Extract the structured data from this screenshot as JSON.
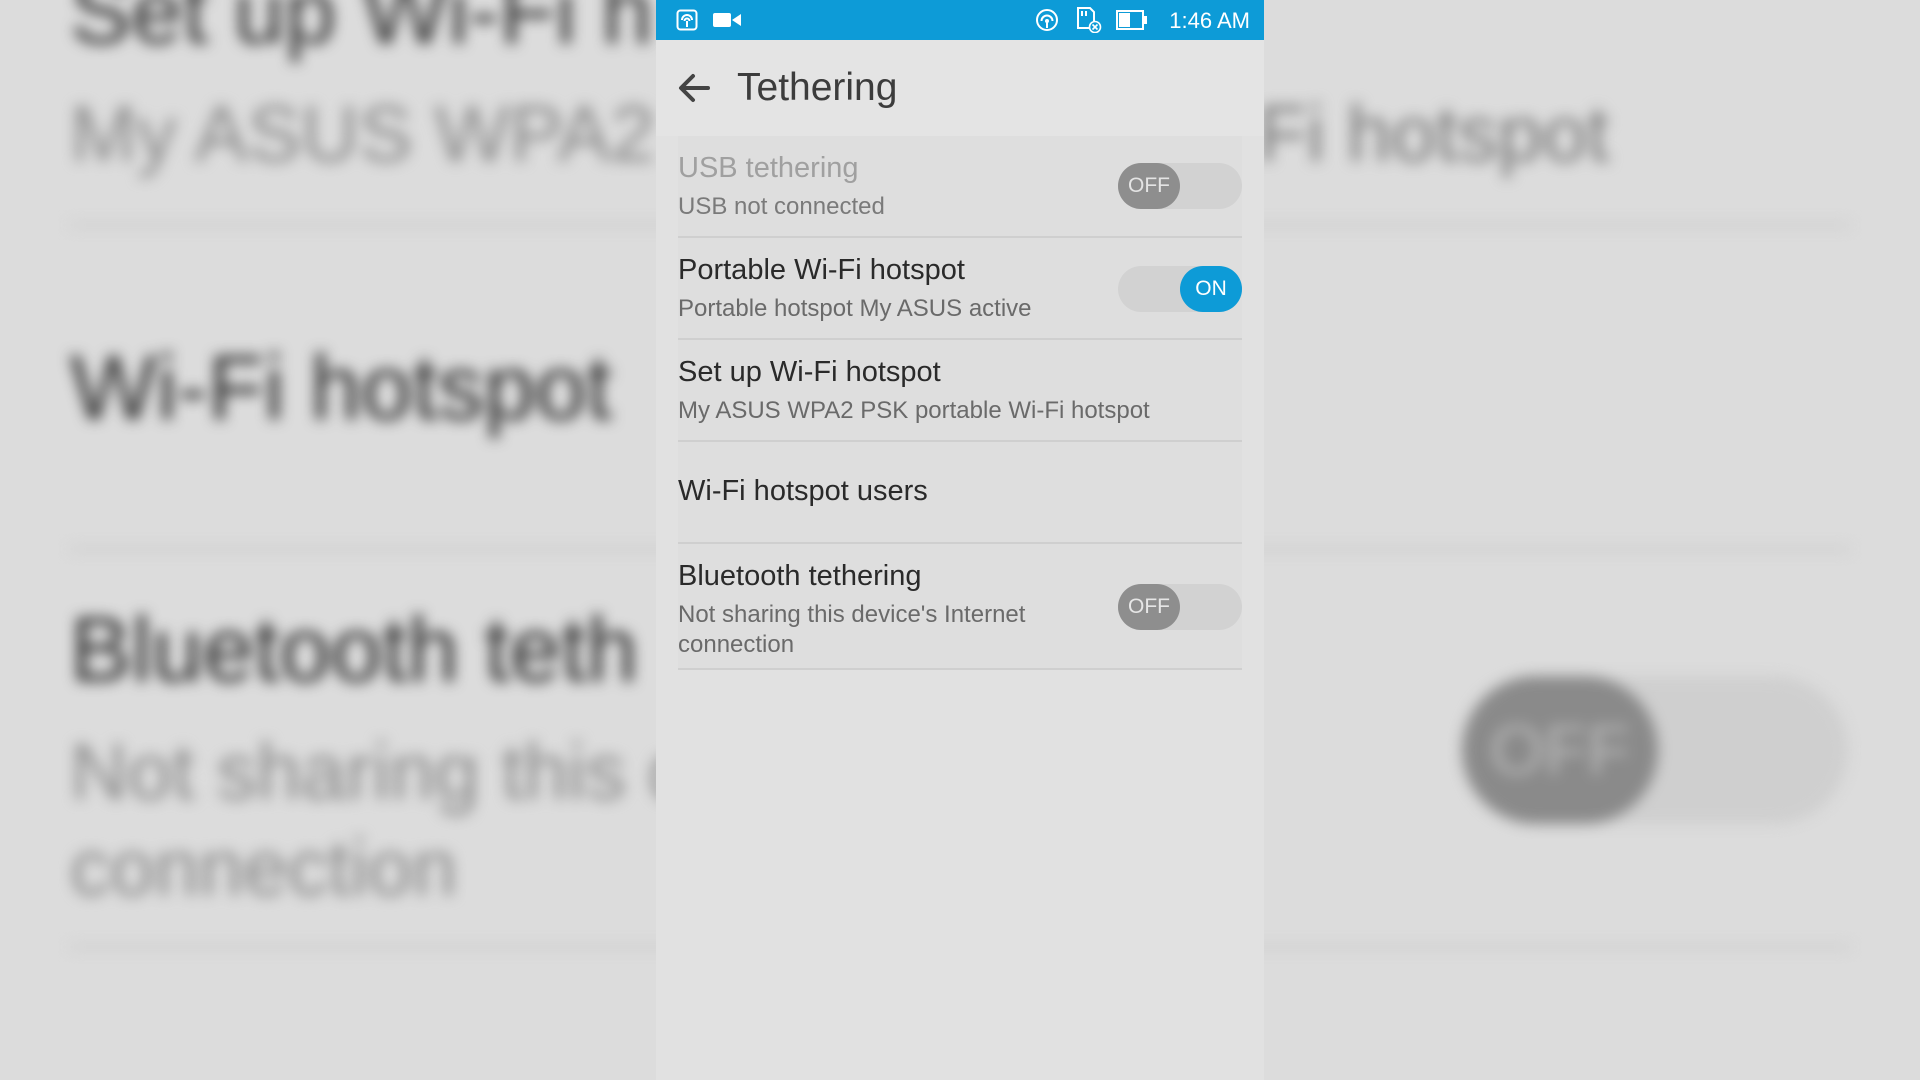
{
  "status_bar": {
    "left_icons": [
      "hotspot-icon",
      "video-camera-icon"
    ],
    "right_icons": [
      "hotspot-active-icon",
      "sd-card-icon",
      "battery-icon"
    ],
    "time": "1:46 AM",
    "color": "#0d9bd7"
  },
  "app_bar": {
    "title": "Tethering",
    "back_icon": "arrow-left-icon"
  },
  "settings": [
    {
      "id": "usb-tethering",
      "title": "USB tethering",
      "summary": "USB not connected",
      "toggle": "OFF",
      "enabled": false
    },
    {
      "id": "wifi-hotspot",
      "title": "Portable Wi-Fi hotspot",
      "summary": "Portable hotspot My ASUS active",
      "toggle": "ON",
      "enabled": true
    },
    {
      "id": "setup-hotspot",
      "title": "Set up Wi-Fi hotspot",
      "summary": "My ASUS WPA2 PSK portable Wi-Fi hotspot"
    },
    {
      "id": "hotspot-users",
      "title": "Wi-Fi hotspot users"
    },
    {
      "id": "bluetooth-tethering",
      "title": "Bluetooth tethering",
      "summary": "Not sharing this device's Internet connection",
      "summary_line1": "Not sharing this device's Internet",
      "summary_line2": "connection",
      "toggle": "OFF",
      "enabled": true
    }
  ],
  "background": {
    "line1": "Set up Wi-Fi h",
    "line2": "My ASUS WPA2 P",
    "line2_right": "Fi hotspot",
    "line3": "Wi-Fi hotspot",
    "line4": "Bluetooth teth",
    "line5": "Not sharing this d",
    "line6": "connection",
    "toggle": "OFF"
  },
  "accent_color": "#0d9bd7"
}
